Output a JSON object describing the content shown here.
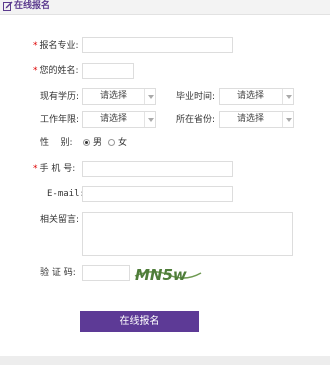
{
  "header": {
    "title": "在线报名"
  },
  "form": {
    "major": {
      "label": "报名专业:",
      "required": true
    },
    "name": {
      "label": "您的姓名:",
      "required": true
    },
    "education": {
      "label": "现有学历:",
      "value": "请选择"
    },
    "graduation_time": {
      "label": "毕业时间:",
      "value": "请选择"
    },
    "work_years": {
      "label": "工作年限:",
      "value": "请选择"
    },
    "province": {
      "label": "所在省份:",
      "value": "请选择"
    },
    "gender": {
      "label": "性    别:",
      "options": [
        "男",
        "女"
      ],
      "selected": "男"
    },
    "phone": {
      "label": "手 机 号:",
      "required": true
    },
    "email": {
      "label": "E-mail:"
    },
    "message": {
      "label": "相关留言:"
    },
    "captcha": {
      "label": "验 证 码:",
      "image_text": "MN5w"
    },
    "submit_label": "在线报名"
  },
  "colors": {
    "accent": "#5d3a96",
    "required_star": "#dd0000"
  }
}
